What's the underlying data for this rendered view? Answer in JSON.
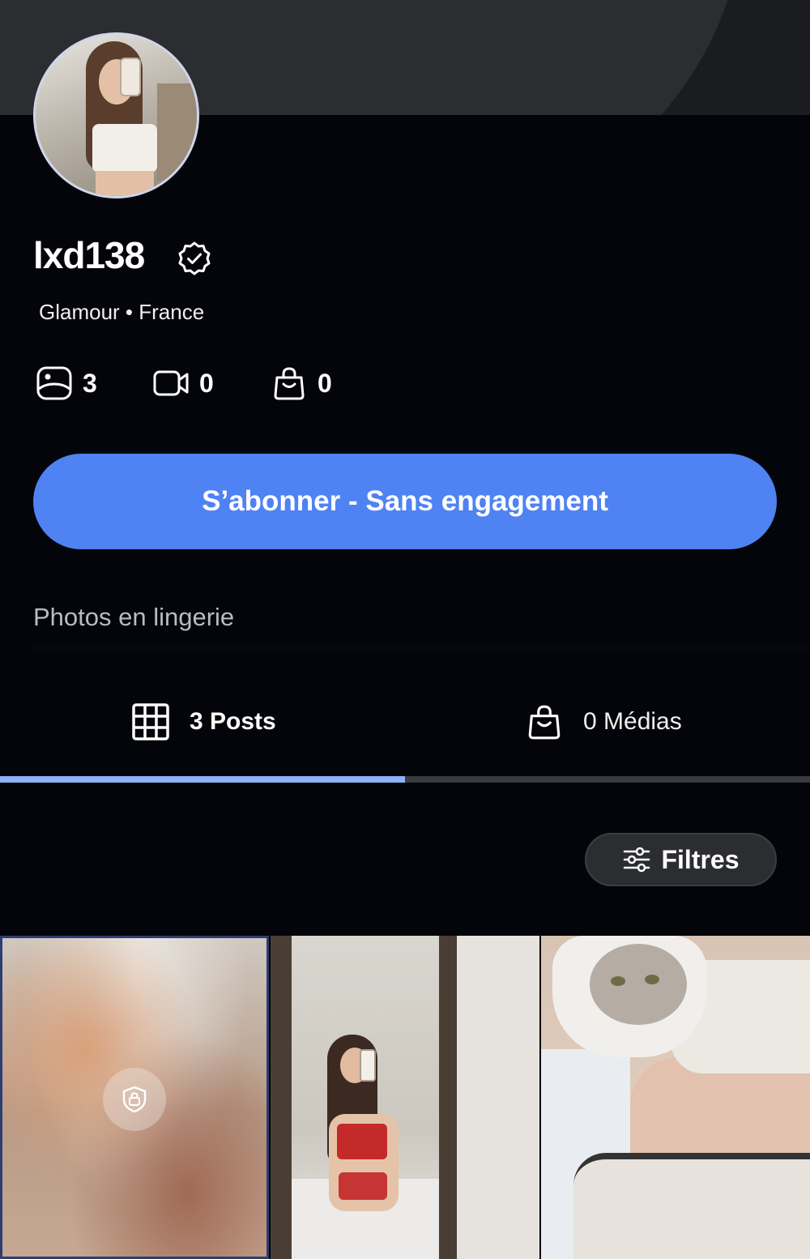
{
  "profile": {
    "username": "lxd138",
    "subtitle": "Glamour • France",
    "stats": {
      "photos": "3",
      "videos": "0",
      "shop": "0"
    },
    "subscribe_label": "S’abonner - Sans engagement",
    "bio": "Photos en lingerie"
  },
  "tabs": {
    "posts_label": "3 Posts",
    "medias_label": "0 Médias",
    "active": "posts"
  },
  "filters_label": "Filtres",
  "colors": {
    "background": "#04050a",
    "accent": "#4f82f3",
    "tab_indicator": "#8eb0f5"
  },
  "icons": [
    "verified-badge-icon",
    "photo-icon",
    "video-icon",
    "shopping-bag-icon",
    "grid-icon",
    "sliders-icon",
    "lock-icon"
  ]
}
